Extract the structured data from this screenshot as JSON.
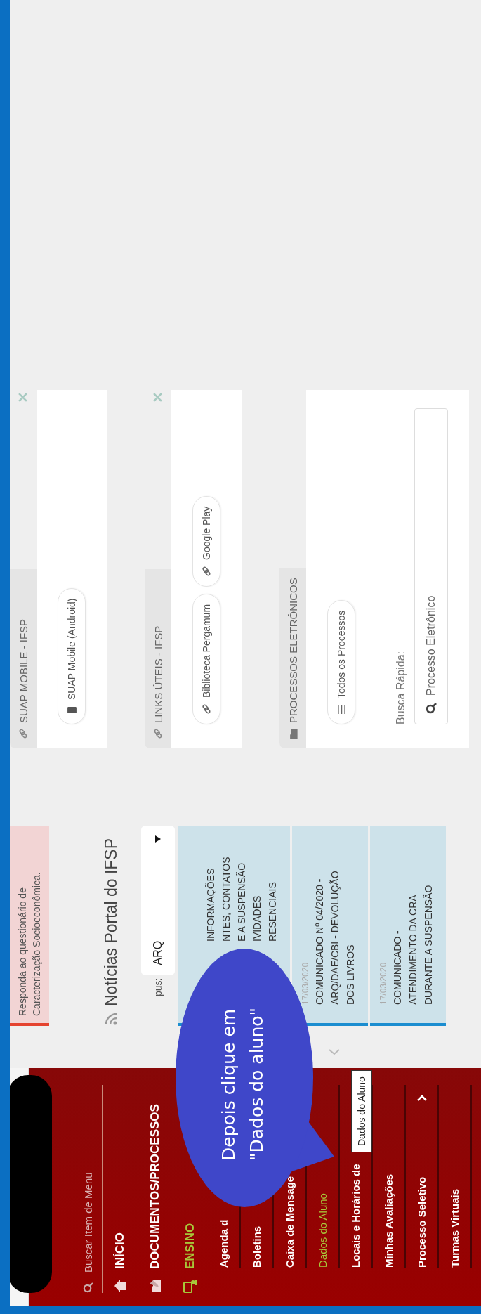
{
  "sidebar": {
    "search": {
      "placeholder": "Buscar Item de Menu"
    },
    "items": [
      {
        "label": "INÍCIO",
        "kind": "home",
        "selected": false
      },
      {
        "label": "DOCUMENTOS/PROCESSOS",
        "kind": "documents",
        "selected": false
      },
      {
        "label": "ENSINO",
        "kind": "teaching",
        "selected": true,
        "children": [
          {
            "label": "Agenda d",
            "selected": false,
            "expandable": false
          },
          {
            "label": "Boletins",
            "selected": false,
            "expandable": false
          },
          {
            "label": "Caixa de Mensage",
            "selected": false,
            "expandable": false
          },
          {
            "label": "Dados do Aluno",
            "selected": true,
            "expandable": false
          },
          {
            "label": "Locais e Horários de",
            "selected": false,
            "expandable": false
          },
          {
            "label": "Minhas Avaliações",
            "selected": false,
            "expandable": false
          },
          {
            "label": "Processo Seletivo",
            "selected": false,
            "expandable": true
          },
          {
            "label": "Turmas Virtuais",
            "selected": false,
            "expandable": false
          }
        ]
      }
    ]
  },
  "tooltip": "Dados do Aluno",
  "callout": {
    "lines": [
      "Depois clique em",
      "\"Dados do aluno\""
    ]
  },
  "alert": {
    "text": "Responda ao questionário de Caracterização Socioeconômica."
  },
  "news": {
    "title": "Notícias Portal do IFSP",
    "campus_label": "pus:",
    "campus_value": "ARQ",
    "items": [
      {
        "kind": "covered",
        "lines": [
          "INFORMAÇÕES",
          "NTES, CONTATOS",
          "E A SUSPENSÃO",
          "IVIDADES",
          "RESENCIAIS"
        ]
      },
      {
        "kind": "news",
        "date": "17/03/2020",
        "lines": [
          "COMUNICADO Nº 04/2020 -",
          "ARQ/DAE/CBI - DEVOLUÇÃO",
          "DOS LIVROS"
        ]
      },
      {
        "kind": "news",
        "date": "17/03/2020",
        "lines": [
          "COMUNICADO -",
          "ATENDIMENTO DA CRA",
          "DURANTE A SUSPENSÃO"
        ]
      }
    ]
  },
  "cards": [
    {
      "title": "SUAP MOBILE - IFSP",
      "kind": "link",
      "closable": true,
      "links": [
        {
          "label": "SUAP Mobile (Android)",
          "kind": "phone"
        }
      ]
    },
    {
      "title": "LINKS ÚTEIS - IFSP",
      "kind": "link",
      "closable": true,
      "links": [
        {
          "label": "Biblioteca Pergamum",
          "kind": "link"
        },
        {
          "label": "Google Play",
          "kind": "link"
        }
      ]
    },
    {
      "title": "PROCESSOS ELETRÔNICOS",
      "kind": "folder",
      "closable": false,
      "links": [
        {
          "label": "Todos os Processos",
          "kind": "list"
        }
      ],
      "search_label": "Busca Rápida:",
      "search_placeholder": "Processo Eletrônico"
    }
  ]
}
